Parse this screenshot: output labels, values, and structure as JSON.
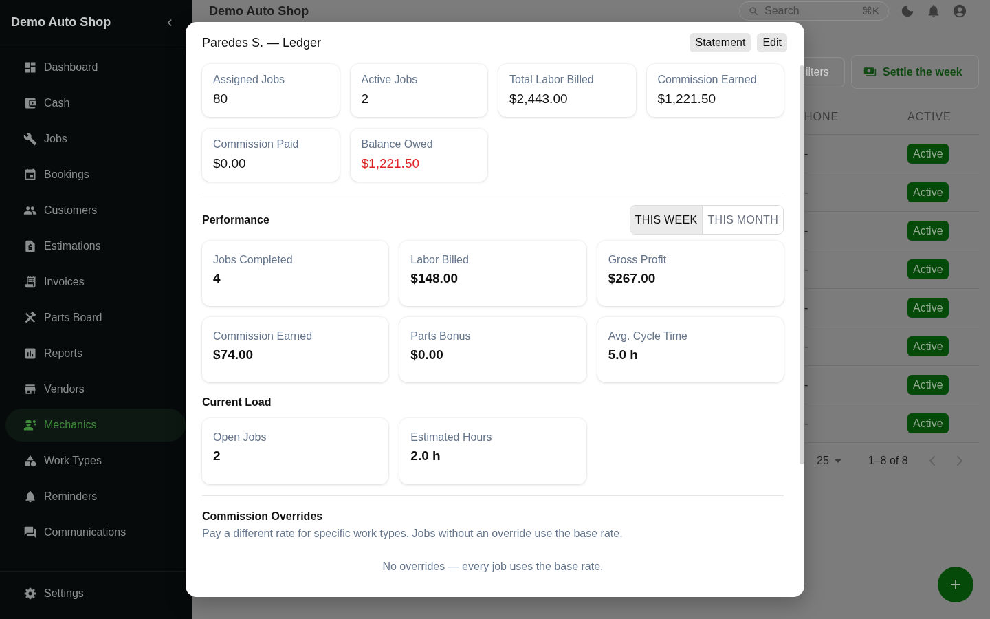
{
  "sidebar": {
    "title": "Demo Auto Shop",
    "items": [
      {
        "label": "Dashboard",
        "selected": false
      },
      {
        "label": "Cash",
        "selected": false
      },
      {
        "label": "Jobs",
        "selected": false
      },
      {
        "label": "Bookings",
        "selected": false
      },
      {
        "label": "Customers",
        "selected": false
      },
      {
        "label": "Estimations",
        "selected": false
      },
      {
        "label": "Invoices",
        "selected": false
      },
      {
        "label": "Parts Board",
        "selected": false
      },
      {
        "label": "Reports",
        "selected": false
      },
      {
        "label": "Vendors",
        "selected": false
      },
      {
        "label": "Mechanics",
        "selected": true
      },
      {
        "label": "Work Types",
        "selected": false
      },
      {
        "label": "Reminders",
        "selected": false
      },
      {
        "label": "Communications",
        "selected": false
      }
    ],
    "footer_items": [
      {
        "label": "Settings",
        "selected": false
      }
    ]
  },
  "topbar": {
    "title": "Demo Auto Shop",
    "search": {
      "placeholder": "Search",
      "shortcut": "⌘K"
    }
  },
  "toolbar": {
    "buttons": [
      {
        "label": "ilters",
        "kind": "outline"
      },
      {
        "label": "Settle the week",
        "kind": "primary"
      }
    ]
  },
  "table": {
    "columns": [
      {
        "label": "HONE",
        "kind": "text"
      },
      {
        "label": "ACTIVE",
        "kind": "badge"
      }
    ],
    "rows": [
      {
        "cells": [
          "-",
          "Active"
        ]
      },
      {
        "cells": [
          "-",
          "Active"
        ]
      },
      {
        "cells": [
          "-",
          "Active"
        ]
      },
      {
        "cells": [
          "-",
          "Active"
        ]
      },
      {
        "cells": [
          "-",
          "Active"
        ]
      },
      {
        "cells": [
          "-",
          "Active"
        ]
      },
      {
        "cells": [
          "-",
          "Active"
        ]
      },
      {
        "cells": [
          "-",
          "Active"
        ]
      }
    ]
  },
  "pagination": {
    "rows_per_page": "25",
    "range": "1–8 of 8"
  },
  "modal": {
    "title": "Paredes S. — Ledger",
    "actions": [
      "Statement",
      "Edit"
    ],
    "summary": [
      {
        "label": "Assigned Jobs",
        "value": "80",
        "negative": false
      },
      {
        "label": "Active Jobs",
        "value": "2",
        "negative": false
      },
      {
        "label": "Total Labor Billed",
        "value": "$2,443.00",
        "negative": false
      },
      {
        "label": "Commission Earned",
        "value": "$1,221.50",
        "negative": false
      },
      {
        "label": "Commission Paid",
        "value": "$0.00",
        "negative": false
      },
      {
        "label": "Balance Owed",
        "value": "$1,221.50",
        "negative": true
      }
    ],
    "performance": {
      "title": "Performance",
      "periods": [
        {
          "label": "THIS WEEK",
          "selected": true
        },
        {
          "label": "THIS MONTH",
          "selected": false
        }
      ],
      "stats": [
        {
          "label": "Jobs Completed",
          "value": "4"
        },
        {
          "label": "Labor Billed",
          "value": "$148.00"
        },
        {
          "label": "Gross Profit",
          "value": "$267.00"
        },
        {
          "label": "Commission Earned",
          "value": "$74.00"
        },
        {
          "label": "Parts Bonus",
          "value": "$0.00"
        },
        {
          "label": "Avg. Cycle Time",
          "value": "5.0 h"
        }
      ]
    },
    "current_load": {
      "title": "Current Load",
      "stats": [
        {
          "label": "Open Jobs",
          "value": "2"
        },
        {
          "label": "Estimated Hours",
          "value": "2.0 h"
        }
      ]
    },
    "overrides": {
      "title": "Commission Overrides",
      "description": "Pay a different rate for specific work types. Jobs without an override use the base rate.",
      "empty_text": "No overrides — every job uses the base rate."
    }
  }
}
